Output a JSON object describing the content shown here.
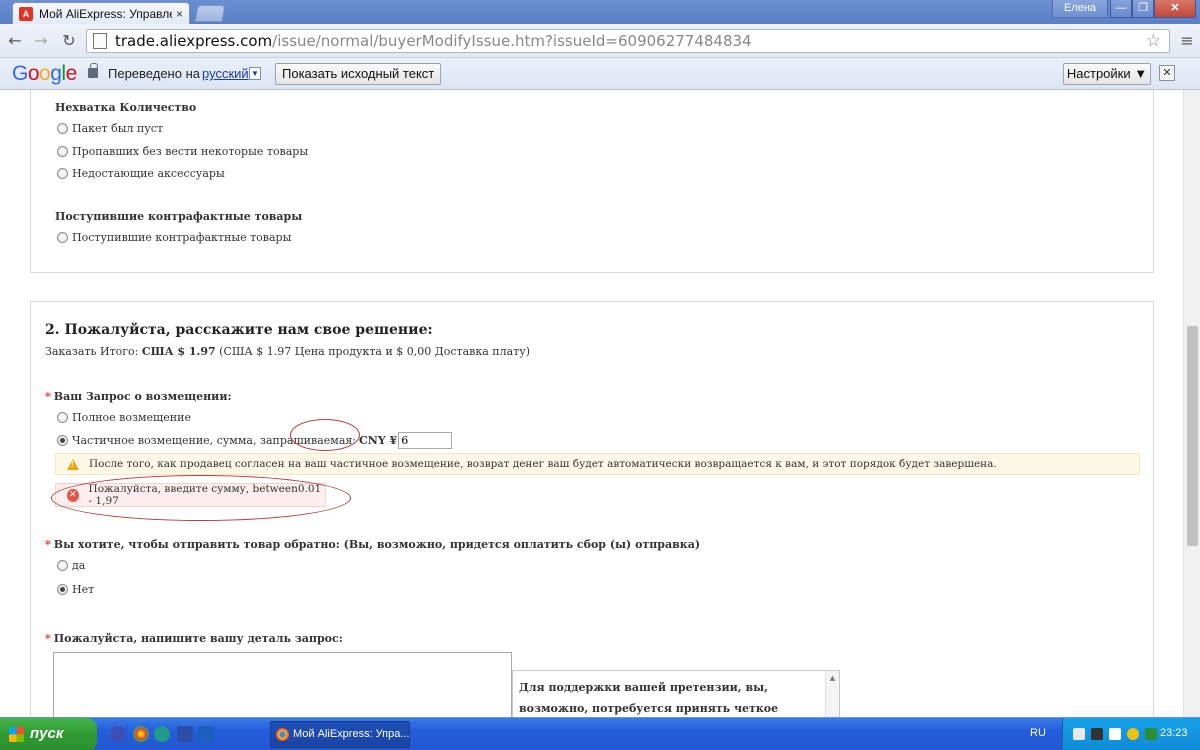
{
  "browser": {
    "tab_title": "Мой AliExpress: Управление",
    "tab_close": "×",
    "user_name": "Елена",
    "win_min": "—",
    "win_max": "❐",
    "win_close": "✕",
    "url_host": "trade.aliexpress.com",
    "url_path": "/issue/normal/buyerModifyIssue.htm?issueId=60906277484834"
  },
  "translate_bar": {
    "translated_to": "Переведено на",
    "language": "русский",
    "show_original": "Показать исходный текст",
    "settings": "Настройки ▼",
    "close": "✕"
  },
  "section1": {
    "group1_label": "Нехватка Количество",
    "group1_options": [
      "Пакет был пуст",
      "Пропавших без вести некоторые товары",
      "Недостающие аксессуары"
    ],
    "group2_label": "Поступившие контрафактные товары",
    "group2_options": [
      "Поступившие контрафактные товары"
    ]
  },
  "section2": {
    "title": "2. Пожалуйста, расскажите нам свое решение:",
    "order_total_prefix": "Заказать Итого:",
    "order_total_value": "США $ 1.97",
    "order_total_detail": "(США $ 1.97 Цена продукта и $ 0,00 Доставка плату)",
    "refund_label": "Ваш Запрос о возмещении:",
    "refund_full": "Полное возмещение",
    "refund_partial": "Частичное возмещение, сумма, запрашиваемая:",
    "currency": "CNY ¥",
    "amount_value": "6",
    "warning_text": "После того, как продавец согласен на ваш частичное возмещение, возврат денег ваш будет автоматически возвращается к вам, и этот порядок будет завершена.",
    "error_text": "Пожалуйста, введите сумму, between0.01 - 1,97",
    "return_label": "Вы хотите, чтобы отправить товар обратно: (Вы, возможно, придется оплатить сбор (ы) отправка)",
    "return_yes": "да",
    "return_no": "Нет",
    "detail_label": "Пожалуйста, напишите вашу деталь запрос:",
    "tip_text": "Для поддержки вашей претензии, вы, возможно, потребуется принять четкое изображение продукта,"
  },
  "taskbar": {
    "start": "пуск",
    "task_title": "Мой AliExpress: Упра...",
    "lang": "RU",
    "clock": "23:23"
  }
}
